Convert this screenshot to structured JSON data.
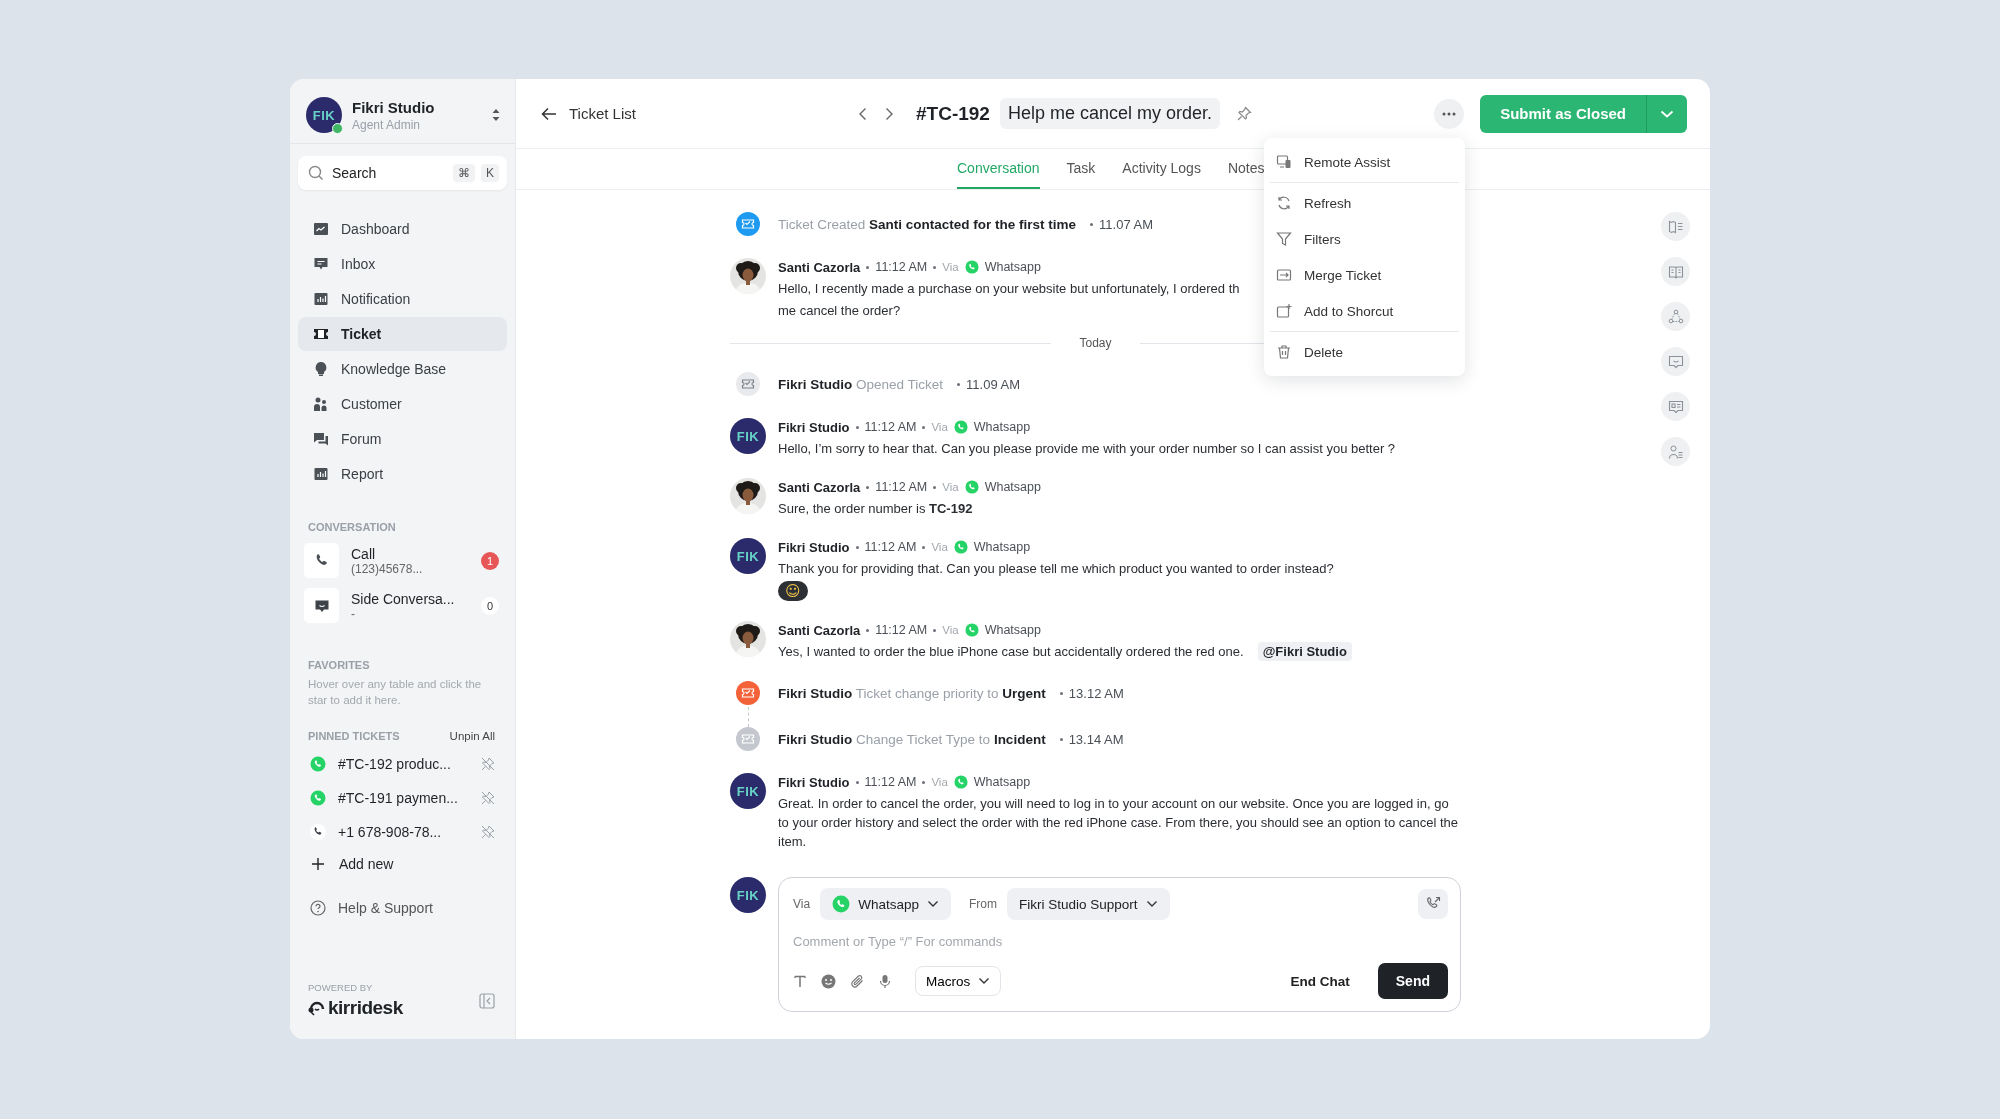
{
  "workspace": {
    "name": "Fikri Studio",
    "role": "Agent Admin",
    "initials": "FIK",
    "online": true
  },
  "search": {
    "placeholder": "Search",
    "keys": [
      "⌘",
      "K"
    ]
  },
  "nav": [
    {
      "label": "Dashboard",
      "selected": false
    },
    {
      "label": "Inbox",
      "selected": false
    },
    {
      "label": "Notification",
      "selected": false
    },
    {
      "label": "Ticket",
      "selected": true
    },
    {
      "label": "Knowledge Base",
      "selected": false
    },
    {
      "label": "Customer",
      "selected": false
    },
    {
      "label": "Forum",
      "selected": false
    },
    {
      "label": "Report",
      "selected": false
    }
  ],
  "conversations": {
    "title": "CONVERSATION",
    "items": [
      {
        "kind": "call",
        "title": "Call",
        "subtitle": "(123)45678...",
        "count": "1",
        "unread": true
      },
      {
        "kind": "side",
        "title": "Side Conversa...",
        "subtitle": "-",
        "count": "0",
        "unread": false
      }
    ]
  },
  "favorites": {
    "title": "FAVORITES",
    "hint": "Hover over any table and click the star to add it here."
  },
  "pinned": {
    "title": "PINNED TICKETS",
    "action": "Unpin All",
    "add": "Add new",
    "items": [
      {
        "kind": "whatsapp",
        "label": "#TC-192 produc..."
      },
      {
        "kind": "whatsapp",
        "label": "#TC-191 paymen..."
      },
      {
        "kind": "phone",
        "label": "+1 678-908-78..."
      }
    ]
  },
  "help": "Help & Support",
  "brand": {
    "powered_by": "POWERED BY",
    "name": "kirridesk"
  },
  "header": {
    "back": "Ticket List",
    "ticket_id": "#TC-192",
    "subject": "Help me cancel my order.",
    "primary": "Submit as Closed"
  },
  "tabs": [
    {
      "label": "Conversation",
      "selected": true
    },
    {
      "label": "Task",
      "selected": false
    },
    {
      "label": "Activity Logs",
      "selected": false
    },
    {
      "label": "Notes",
      "selected": false
    }
  ],
  "menu": [
    {
      "items": [
        {
          "label": "Remote Assist"
        }
      ]
    },
    {
      "items": [
        {
          "label": "Refresh"
        },
        {
          "label": "Filters"
        },
        {
          "label": "Merge Ticket"
        },
        {
          "label": "Add to Shorcut"
        }
      ]
    },
    {
      "items": [
        {
          "label": "Delete"
        }
      ]
    }
  ],
  "timeline": [
    {
      "kind": "event",
      "color": "#1e9bf0",
      "action": "Ticket Created",
      "detail": "Santi contacted for the first time",
      "time": "11.07 AM"
    },
    {
      "kind": "message",
      "author": "Santi Cazorla",
      "time": "11:12 AM",
      "via": "Via",
      "channel": "Whatsapp",
      "lines": [
        "Hello, I recently made a purchase on your website but unfortunately, I ordered th",
        "me cancel the order?"
      ]
    },
    {
      "kind": "divider",
      "label": "Today"
    },
    {
      "kind": "event",
      "color": "#e8eaed",
      "actor": "Fikri Studio",
      "action": "Opened Ticket",
      "time": "11.09 AM"
    },
    {
      "kind": "message",
      "author": "Fikri Studio",
      "initials": "FIK",
      "time": "11:12 AM",
      "via": "Via",
      "channel": "Whatsapp",
      "lines": [
        "Hello, I’m sorry to hear that. Can you please provide me with your order number so I can assist you better ?"
      ]
    },
    {
      "kind": "message",
      "author": "Santi Cazorla",
      "time": "11:12 AM",
      "via": "Via",
      "channel": "Whatsapp",
      "lines": [
        "Sure, the order number is **TC-192**"
      ]
    },
    {
      "kind": "message",
      "author": "Fikri Studio",
      "initials": "FIK",
      "time": "11:12 AM",
      "via": "Via",
      "channel": "Whatsapp",
      "lines": [
        "Thank you for providing that. Can you please tell me which product you wanted to order instead?"
      ],
      "reaction": "☺"
    },
    {
      "kind": "message",
      "author": "Santi Cazorla",
      "time": "11:12 AM",
      "via": "Via",
      "channel": "Whatsapp",
      "lines": [
        "Yes, I wanted to order the blue iPhone case but accidentally ordered the red one."
      ],
      "mention": "@Fikri Studio"
    },
    {
      "kind": "event",
      "color": "#f4623a",
      "actor": "Fikri Studio",
      "action": "Ticket change priority to",
      "detail": "Urgent",
      "time": "13.12 AM",
      "linked": true
    },
    {
      "kind": "event",
      "color": "#c4c8ce",
      "actor": "Fikri Studio",
      "action": "Change Ticket Type to",
      "detail": "Incident",
      "time": "13.14 AM"
    },
    {
      "kind": "message",
      "author": "Fikri Studio",
      "initials": "FIK",
      "time": "11:12 AM",
      "via": "Via",
      "channel": "Whatsapp",
      "lines": [
        "Great. In order to cancel the order, you will need to log in to your account on our website. Once you are logged in, go to your order history and select the order with the red iPhone case. From there, you should see an option to cancel the item."
      ]
    }
  ],
  "composer": {
    "initials": "FIK",
    "via_label": "Via",
    "channel": "Whatsapp",
    "from_label": "From",
    "from": "Fikri Studio Support",
    "placeholder": "Comment or Type “/” For commands",
    "macros": "Macros",
    "end": "End Chat",
    "send": "Send"
  }
}
